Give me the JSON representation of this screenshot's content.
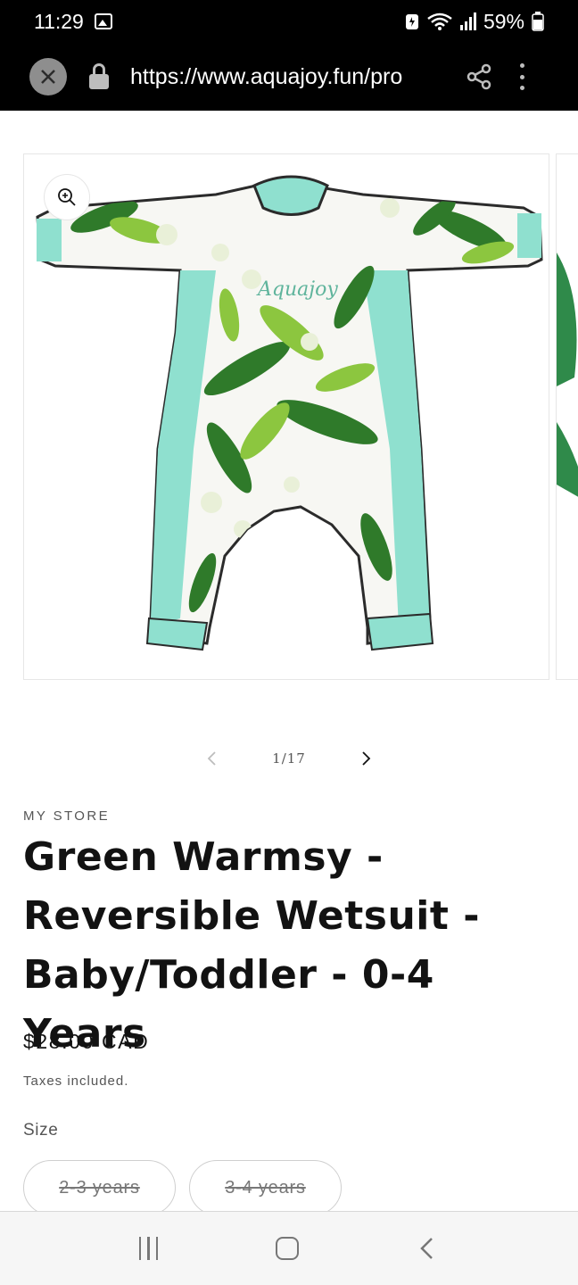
{
  "status_bar": {
    "time": "11:29",
    "battery": "59%",
    "icons": [
      "gallery-icon",
      "battery-saver-icon",
      "wifi-icon",
      "signal-icon",
      "battery-icon"
    ]
  },
  "browser": {
    "url": "https://www.aquajoy.fun/pro",
    "icons": [
      "close-icon",
      "lock-icon",
      "share-icon",
      "more-vert-icon"
    ]
  },
  "gallery": {
    "counter": "1/17",
    "logo_text": "Aquajoy",
    "icons": [
      "zoom-in-icon",
      "chevron-left-icon",
      "chevron-right-icon"
    ]
  },
  "product": {
    "vendor": "MY STORE",
    "title": "Green Warmsy - Reversible Wetsuit - Baby/Toddler - 0-4 Years",
    "price": "$28.00 CAD",
    "tax_note": "Taxes included.",
    "size_label": "Size",
    "sizes": [
      {
        "label": "2-3 years"
      },
      {
        "label": "3-4 years"
      }
    ]
  },
  "nav_bar": {
    "icons": [
      "recents-icon",
      "home-icon",
      "back-icon"
    ]
  },
  "colors": {
    "aqua": "#8fe0cf",
    "leaf_dark": "#2f7a2a",
    "leaf_light": "#8cc63f"
  }
}
